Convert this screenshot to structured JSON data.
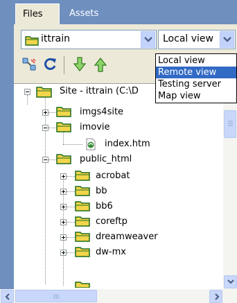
{
  "tabs": [
    {
      "label": "Files",
      "active": true
    },
    {
      "label": "Assets",
      "active": false
    }
  ],
  "site_select": {
    "value": "ittrain"
  },
  "view_select": {
    "value": "Local view"
  },
  "toolbar": {
    "items": [
      "connect-icon",
      "refresh-icon",
      "get-icon",
      "put-icon"
    ]
  },
  "dropdown": {
    "options": [
      {
        "label": "Local view",
        "selected": false
      },
      {
        "label": "Remote view",
        "selected": true
      },
      {
        "label": "Testing server",
        "selected": false
      },
      {
        "label": "Map view",
        "selected": false
      }
    ]
  },
  "tree": {
    "root": "Site - ittrain (C:\\D",
    "items": [
      {
        "label": "imgs4site",
        "type": "folder",
        "expander": "plus"
      },
      {
        "label": "imovie",
        "type": "folder",
        "expander": "minus"
      },
      {
        "label": "index.htm",
        "type": "file"
      },
      {
        "label": "public_html",
        "type": "folder",
        "expander": "minus"
      },
      {
        "label": "acrobat",
        "type": "folder",
        "expander": "plus"
      },
      {
        "label": "bb",
        "type": "folder",
        "expander": "plus"
      },
      {
        "label": "bb6",
        "type": "folder",
        "expander": "plus"
      },
      {
        "label": "coreftp",
        "type": "folder",
        "expander": "plus"
      },
      {
        "label": "dreamweaver",
        "type": "folder",
        "expander": "plus"
      },
      {
        "label": "dw-mx",
        "type": "folder",
        "expander": "plus"
      }
    ]
  },
  "colors": {
    "panel_header": "#6f8fbf",
    "selection": "#316ac5",
    "folder": "#f2d54a",
    "face": "#ece9d8"
  }
}
